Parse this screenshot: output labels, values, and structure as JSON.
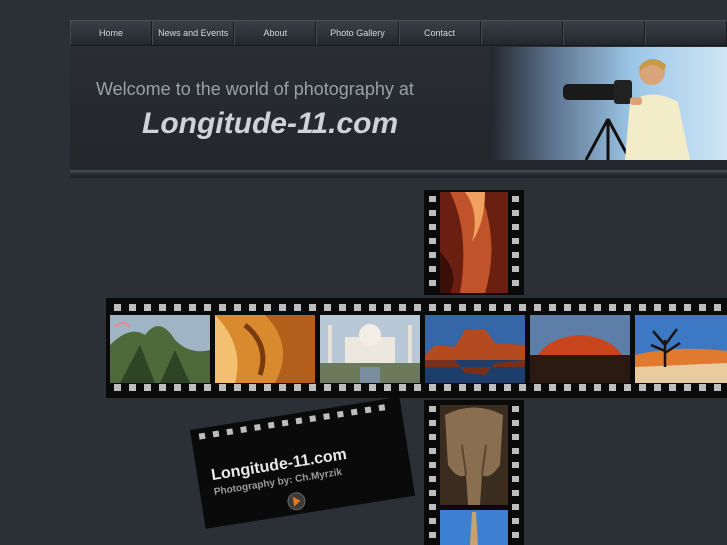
{
  "nav": {
    "items": [
      {
        "label": "Home"
      },
      {
        "label": "News and Events"
      },
      {
        "label": "About"
      },
      {
        "label": "Photo Gallery"
      },
      {
        "label": "Contact"
      },
      {
        "label": ""
      },
      {
        "label": ""
      },
      {
        "label": ""
      }
    ]
  },
  "banner": {
    "welcome": "Welcome to the world of photography at",
    "title": "Longitude-11.com"
  },
  "promo": {
    "title": "Longitude-11.com",
    "subtitle": "Photography by: Ch.Myrzik"
  },
  "gallery": {
    "frames": [
      "antelope-canyon-photo",
      "green-mountains-photo",
      "desert-sandstone-photo",
      "taj-mahal-photo",
      "red-rock-reflection-photo",
      "uluru-rock-photo",
      "dead-tree-desert-photo",
      "elephant-photo",
      "minaret-photo"
    ]
  }
}
